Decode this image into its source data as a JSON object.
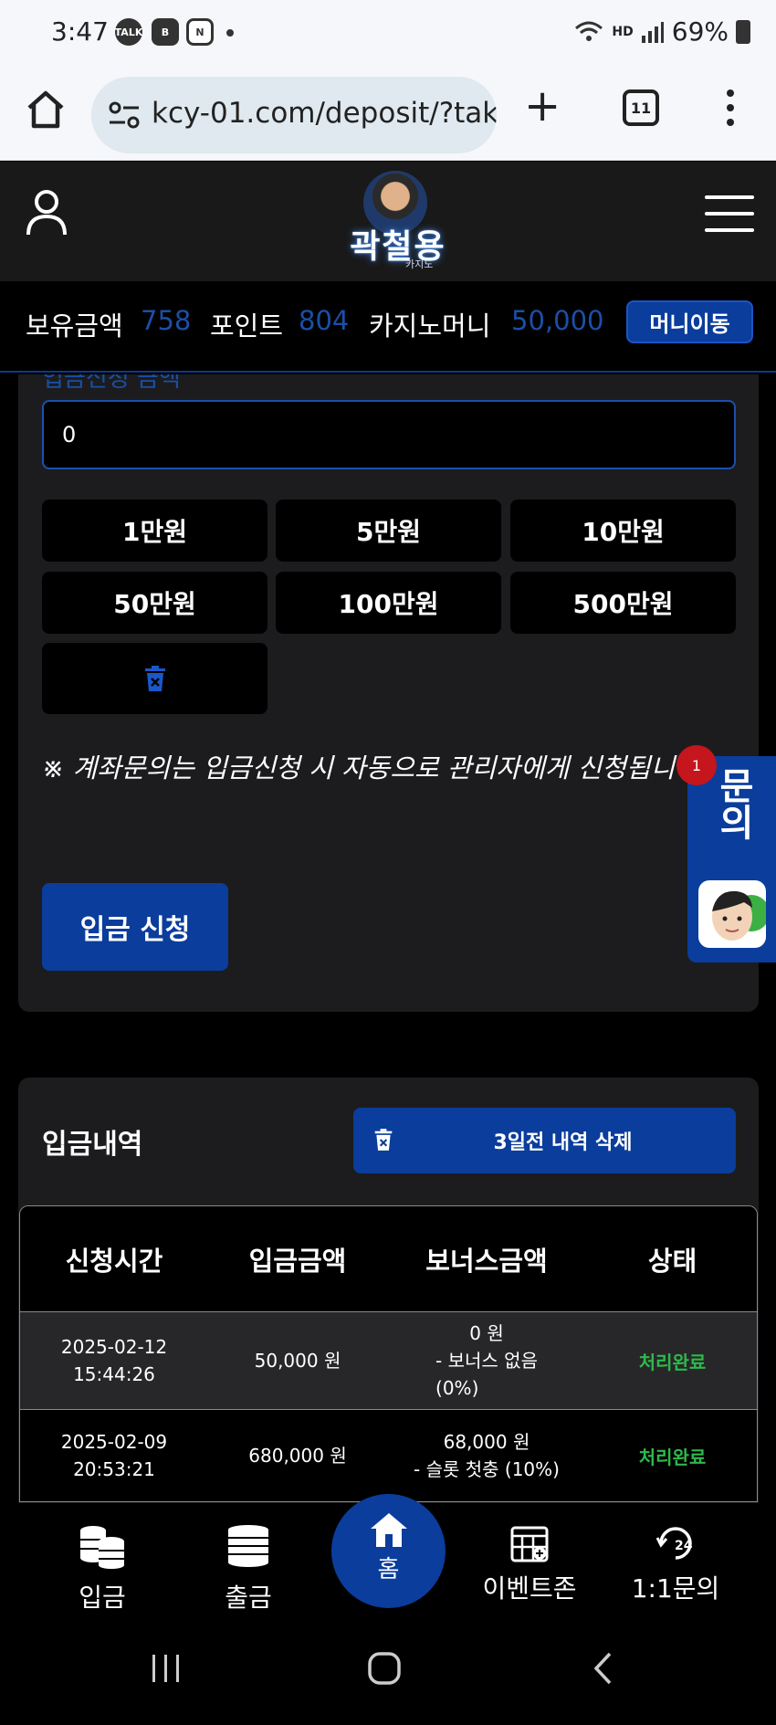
{
  "statusbar": {
    "time": "3:47",
    "talk": "TALK",
    "icon_b": "B",
    "icon_n": "N",
    "hd": "HD",
    "battery": "69%"
  },
  "browser": {
    "url": "kcy-01.com/deposit/?tak",
    "tab_count": "11"
  },
  "site": {
    "logo_text": "곽철용",
    "logo_sub": "카지노"
  },
  "balance": {
    "holding_label": "보유금액",
    "holding_value": "758",
    "point_label": "포인트",
    "point_value": "804",
    "casino_label": "카지노머니",
    "casino_value": "50,000",
    "move_button": "머니이동"
  },
  "deposit": {
    "partial_label": "입금신청 금액",
    "amount_value": "0",
    "quick_amounts": [
      "1만원",
      "5만원",
      "10만원",
      "50만원",
      "100만원",
      "500만원"
    ],
    "notice": "※ 계좌문의는 입금신청 시 자동으로 관리자에게 신청됩니다.",
    "submit_button": "입금 신청"
  },
  "widget": {
    "label": "문의",
    "badge": "1"
  },
  "history": {
    "title": "입금내역",
    "delete_button": "3일전 내역 삭제",
    "columns": [
      "신청시간",
      "입금금액",
      "보너스금액",
      "상태"
    ],
    "rows": [
      {
        "date": "2025-02-12",
        "time": "15:44:26",
        "amount": "50,000 원",
        "bonus_amount": "0 원",
        "bonus_desc": "- 보너스 없음",
        "bonus_rate": "(0%)",
        "status": "처리완료"
      },
      {
        "date": "2025-02-09",
        "time": "20:53:21",
        "amount": "680,000 원",
        "bonus_amount": "68,000 원",
        "bonus_desc": "- 슬롯 첫충 (10%)",
        "bonus_rate": "",
        "status": "처리완료"
      }
    ]
  },
  "bottomnav": {
    "deposit": "입금",
    "withdraw": "출금",
    "home": "홈",
    "event": "이벤트존",
    "inquiry": "1:1문의"
  },
  "colors": {
    "accent": "#0a3d9c",
    "value_blue": "#1b4fa6",
    "status_green": "#2eb84b",
    "card_bg": "#1c1c1e"
  }
}
